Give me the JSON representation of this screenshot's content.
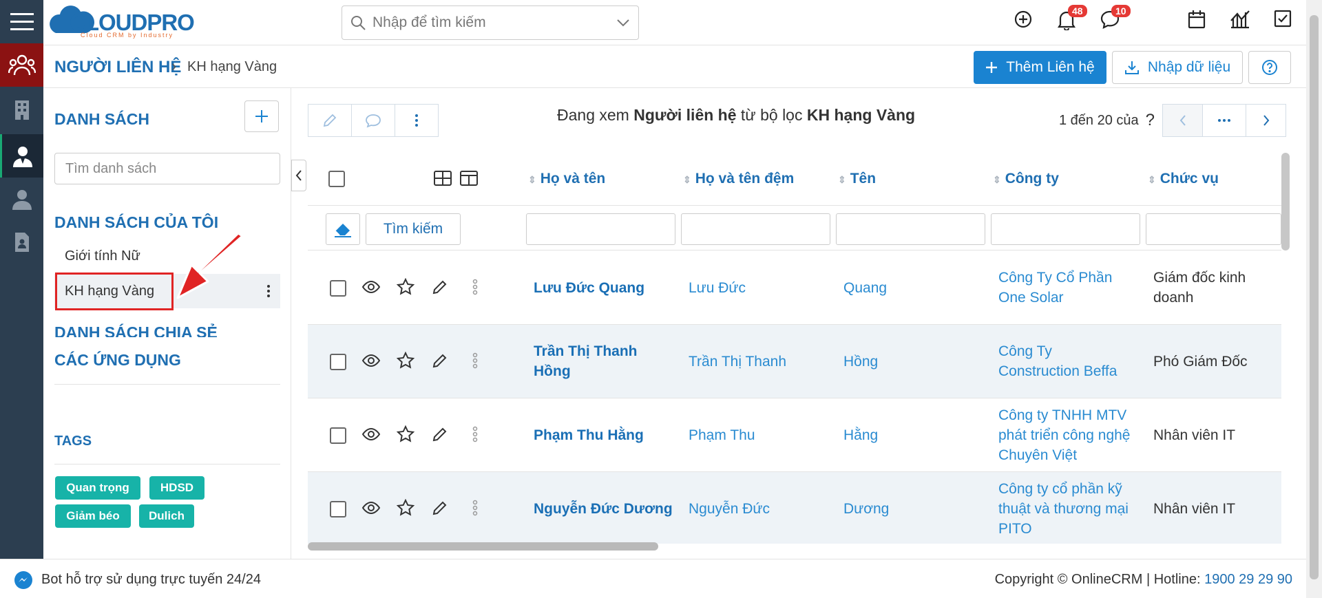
{
  "brand": {
    "logo_text": "CLOUDPRO",
    "logo_tagline": "Cloud CRM by Industry",
    "accent": "#1a83d1",
    "teal": "#17b3a8",
    "highlight": "#e02424"
  },
  "header": {
    "search_placeholder": "Nhập để tìm kiếm",
    "notifications_count": "48",
    "messages_count": "10"
  },
  "breadcrumb": {
    "module": "NGƯỜI LIÊN HỆ",
    "separator": "›",
    "current": "KH hạng Vàng"
  },
  "actions": {
    "add_contact": "Thêm Liên hệ",
    "import_data": "Nhập dữ liệu"
  },
  "sidebar": {
    "list_title": "DANH SÁCH",
    "search_placeholder": "Tìm danh sách",
    "my_lists_title": "DANH SÁCH CỦA TÔI",
    "my_lists": [
      "Giới tính Nữ",
      "KH hạng Vàng"
    ],
    "shared_title": "DANH SÁCH CHIA SẺ",
    "apps_title": "CÁC ỨNG DỤNG",
    "tags_title": "TAGS",
    "tags": [
      "Quan trọng",
      "HDSD",
      "Giảm béo",
      "Dulich"
    ]
  },
  "main": {
    "viewing_prefix": "Đang xem",
    "viewing_module": "Người liên hệ",
    "viewing_middle": "từ bộ lọc",
    "viewing_filter": "KH hạng Vàng",
    "pager_text": "1 đến 20 của",
    "pager_unknown": "?",
    "search_button": "Tìm kiếm",
    "columns": [
      "Họ và tên",
      "Họ và tên đệm",
      "Tên",
      "Công ty",
      "Chức vụ"
    ],
    "rows": [
      {
        "full_name": "Lưu Đức Quang",
        "middle": "Lưu Đức",
        "first": "Quang",
        "company": "Công Ty Cổ Phần One Solar",
        "title": "Giám đốc kinh doanh"
      },
      {
        "full_name": "Trần Thị Thanh Hồng",
        "middle": "Trần Thị Thanh",
        "first": "Hồng",
        "company": "Công Ty Construction Beffa",
        "title": "Phó Giám Đốc"
      },
      {
        "full_name": "Phạm Thu Hằng",
        "middle": "Phạm Thu",
        "first": "Hằng",
        "company": "Công ty TNHH MTV phát triển công nghệ Chuyên Việt",
        "title": "Nhân viên IT"
      },
      {
        "full_name": "Nguyễn Đức Dương",
        "middle": "Nguyễn Đức",
        "first": "Dương",
        "company": "Công ty cổ phần kỹ thuật và thương mại PITO",
        "title": "Nhân viên IT"
      }
    ]
  },
  "footer": {
    "bot_text": "Bot hỗ trợ sử dụng trực tuyến 24/24",
    "copyright": "Copyright © OnlineCRM",
    "hotline_label": "Hotline:",
    "hotline_number": "1900 29 29 90"
  }
}
